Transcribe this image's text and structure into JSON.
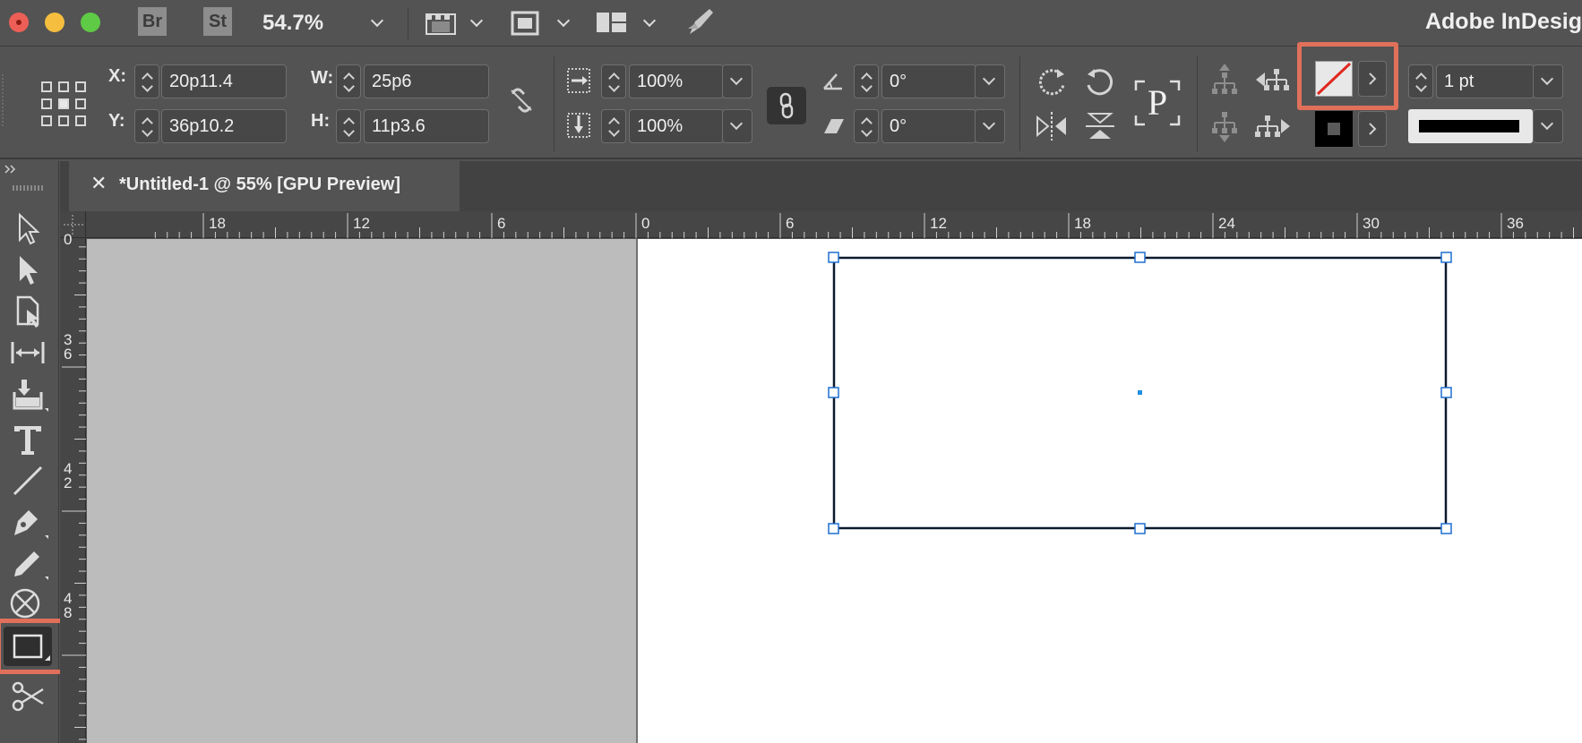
{
  "titlebar": {
    "bridge_label": "Br",
    "stock_label": "St",
    "zoom_value": "54.7%",
    "app_title": "Adobe InDesig"
  },
  "control_panel": {
    "x_label": "X:",
    "x_value": "20p11.4",
    "y_label": "Y:",
    "y_value": "36p10.2",
    "w_label": "W:",
    "w_value": "25p6",
    "h_label": "H:",
    "h_value": "11p3.6",
    "scale_x_value": "100%",
    "scale_y_value": "100%",
    "rotation_value": "0°",
    "shear_value": "0°",
    "stroke_weight_value": "1 pt",
    "text_wrap_glyph": "P"
  },
  "document": {
    "tab_title": "*Untitled-1 @ 55% [GPU Preview]",
    "close_glyph": "✕"
  },
  "rulers": {
    "horizontal": [
      "18",
      "12",
      "6",
      "0",
      "6",
      "12",
      "18",
      "24",
      "30",
      "36"
    ],
    "vertical": [
      "0",
      "3\n6",
      "4\n2",
      "4\n8"
    ]
  },
  "colors": {
    "highlight": "#e0705a",
    "selection": "#1f6fd0",
    "pasteboard": "#bcbcbc"
  }
}
